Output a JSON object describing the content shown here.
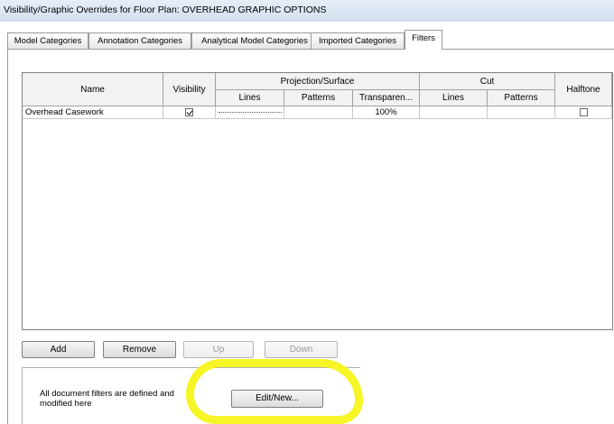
{
  "window": {
    "title": "Visibility/Graphic Overrides for Floor Plan: OVERHEAD GRAPHIC OPTIONS"
  },
  "tabs": [
    {
      "label": "Model Categories",
      "active": false
    },
    {
      "label": "Annotation Categories",
      "active": false
    },
    {
      "label": "Analytical Model Categories",
      "active": false
    },
    {
      "label": "Imported Categories",
      "active": false
    },
    {
      "label": "Filters",
      "active": true
    }
  ],
  "table": {
    "headers": {
      "name": "Name",
      "visibility": "Visibility",
      "projection_surface": "Projection/Surface",
      "cut": "Cut",
      "halftone": "Halftone",
      "proj_lines": "Lines",
      "proj_patterns": "Patterns",
      "proj_transparency": "Transparen...",
      "cut_lines": "Lines",
      "cut_patterns": "Patterns"
    },
    "rows": [
      {
        "name": "Overhead Casework",
        "visibility": true,
        "proj_lines_style": "dashed",
        "proj_patterns": "",
        "transparency": "100%",
        "cut_lines": "",
        "cut_patterns": "",
        "halftone": false
      }
    ]
  },
  "buttons": {
    "add": "Add",
    "remove": "Remove",
    "up": "Up",
    "down": "Down",
    "edit_new": "Edit/New..."
  },
  "info": {
    "text": "All document filters are defined and modified here"
  },
  "colors": {
    "highlight": "#f6f41a",
    "title_bar": "#dce6f2"
  }
}
